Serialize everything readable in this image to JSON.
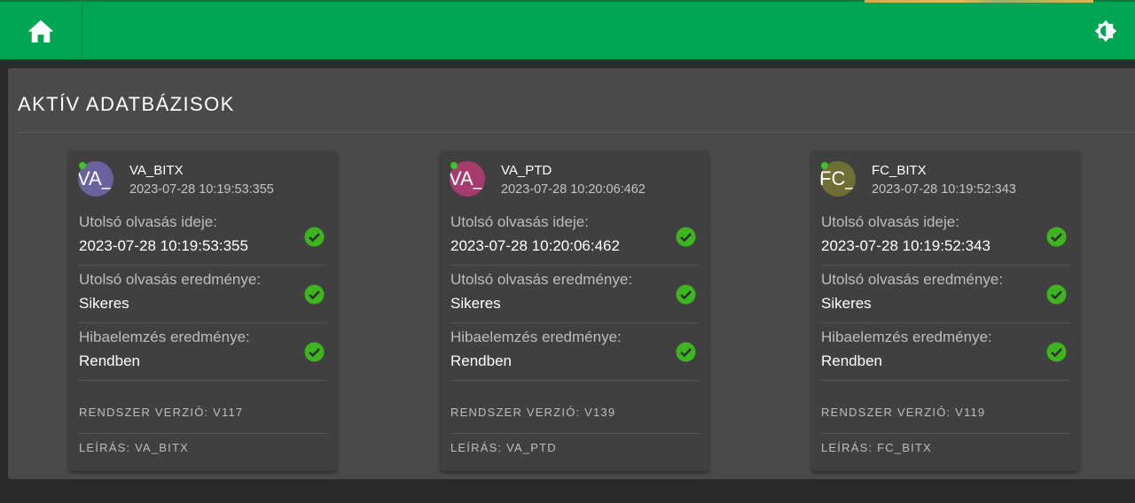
{
  "header": {
    "home_icon": "home-icon",
    "theme_icon": "brightness-icon",
    "accent_color": "#00a651"
  },
  "page": {
    "title": "AKTÍV ADATBÁZISOK"
  },
  "labels": {
    "last_read_time": "Utolsó olvasás ideje:",
    "last_read_result": "Utolsó olvasás eredménye:",
    "error_analysis": "Hibaelemzés eredménye:"
  },
  "cards": [
    {
      "avatar_text": "VA_BITX",
      "avatar_color": "#6a619f",
      "name": "VA_BITX",
      "timestamp": "2023-07-28 10:19:53:355",
      "last_read_time": "2023-07-28 10:19:53:355",
      "last_read_result": "Sikeres",
      "error_analysis": "Rendben",
      "system_version": "RENDSZER VERZIÓ: V117",
      "description": "LEÍRÁS: VA_BITX"
    },
    {
      "avatar_text": "VA_PTD",
      "avatar_color": "#a83b6e",
      "name": "VA_PTD",
      "timestamp": "2023-07-28 10:20:06:462",
      "last_read_time": "2023-07-28 10:20:06:462",
      "last_read_result": "Sikeres",
      "error_analysis": "Rendben",
      "system_version": "RENDSZER VERZIÓ: V139",
      "description": "LEÍRÁS: VA_PTD"
    },
    {
      "avatar_text": "FC_BITX",
      "avatar_color": "#6f6f35",
      "name": "FC_BITX",
      "timestamp": "2023-07-28 10:19:52:343",
      "last_read_time": "2023-07-28 10:19:52:343",
      "last_read_result": "Sikeres",
      "error_analysis": "Rendben",
      "system_version": "RENDSZER VERZIÓ: V119",
      "description": "LEÍRÁS: FC_BITX"
    }
  ]
}
